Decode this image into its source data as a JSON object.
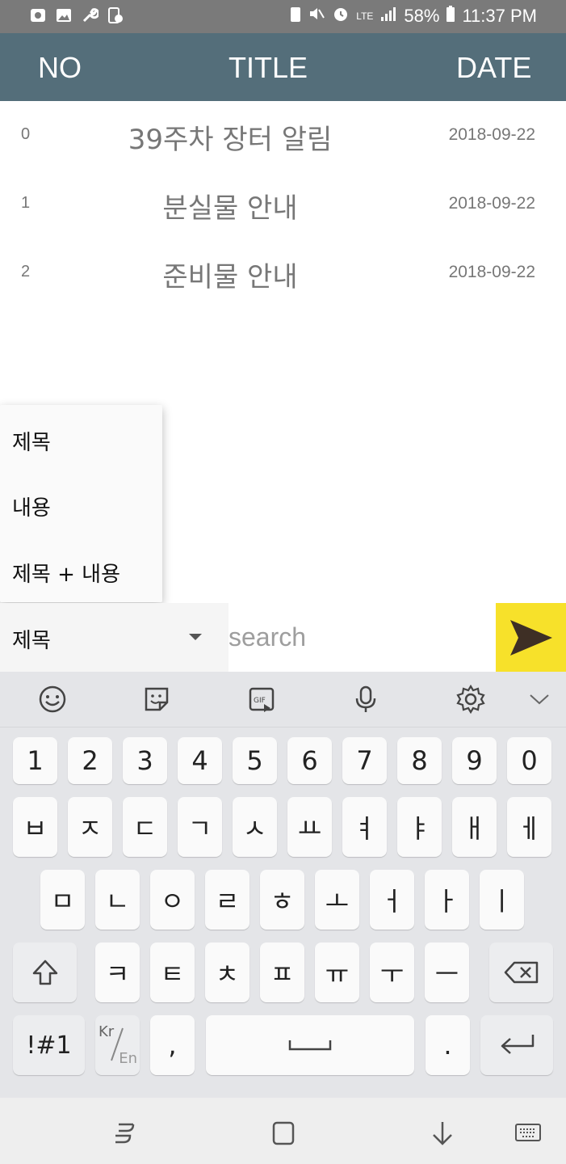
{
  "status_bar": {
    "battery": "58%",
    "time": "11:37 PM",
    "network": "LTE"
  },
  "header": {
    "no": "NO",
    "title": "TITLE",
    "date": "DATE"
  },
  "rows": [
    {
      "no": "0",
      "title": "39주차 장터 알림",
      "date": "2018-09-22"
    },
    {
      "no": "1",
      "title": "분실물 안내",
      "date": "2018-09-22"
    },
    {
      "no": "2",
      "title": "준비물 안내",
      "date": "2018-09-22"
    }
  ],
  "dropdown": {
    "options": [
      "제목",
      "내용",
      "제목 + 내용"
    ],
    "selected": "제목"
  },
  "search": {
    "placeholder": "search"
  },
  "colors": {
    "header_bg": "#546e7a",
    "send_button_bg": "#f7e12a"
  },
  "keyboard": {
    "row_numbers": [
      "1",
      "2",
      "3",
      "4",
      "5",
      "6",
      "7",
      "8",
      "9",
      "0"
    ],
    "row1": [
      "ㅂ",
      "ㅈ",
      "ㄷ",
      "ㄱ",
      "ㅅ",
      "ㅛ",
      "ㅕ",
      "ㅑ",
      "ㅐ",
      "ㅔ"
    ],
    "row2": [
      "ㅁ",
      "ㄴ",
      "ㅇ",
      "ㄹ",
      "ㅎ",
      "ㅗ",
      "ㅓ",
      "ㅏ",
      "ㅣ"
    ],
    "row3": [
      "ㅋ",
      "ㅌ",
      "ㅊ",
      "ㅍ",
      "ㅠ",
      "ㅜ",
      "ㅡ"
    ],
    "symbols_key": "!#1",
    "lang_kr": "Kr",
    "lang_en": "En",
    "comma": ",",
    "period": "."
  }
}
